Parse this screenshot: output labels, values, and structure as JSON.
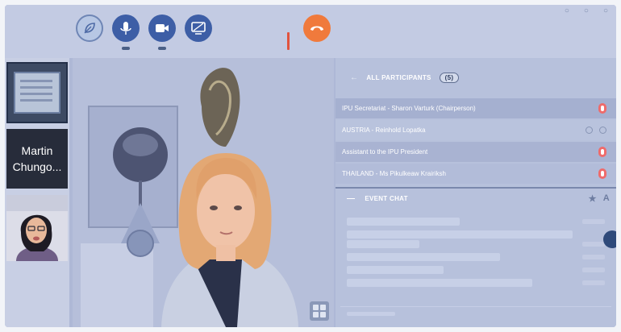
{
  "toolbar": {
    "buttons": [
      {
        "id": "reaction",
        "icon": "leaf-icon",
        "color": "#b9c9e6"
      },
      {
        "id": "mic",
        "icon": "microphone-icon",
        "color": "#3d5ea6"
      },
      {
        "id": "camera",
        "icon": "camera-icon",
        "color": "#3d5ea6"
      },
      {
        "id": "share",
        "icon": "screen-share-icon",
        "color": "#3d5ea6"
      },
      {
        "id": "hangup",
        "icon": "hang-up-icon",
        "color": "#f07a3c"
      }
    ]
  },
  "thumbnails": {
    "name_tile": "Martin Chungo..."
  },
  "participants": {
    "header": "ALL PARTICIPANTS",
    "count": "(5)",
    "rows": [
      {
        "name": "IPU Secretariat - Sharon Varturk (Chairperson)",
        "muted": true
      },
      {
        "name": "AUSTRIA - Reinhold Lopatka",
        "muted": false
      },
      {
        "name": "Assistant to the IPU President",
        "muted": true
      },
      {
        "name": "THAILAND - Ms Pikulkeaw Krairiksh",
        "muted": true
      }
    ]
  },
  "chat": {
    "header": "EVENT CHAT"
  },
  "colors": {
    "accent": "#3d5ea6",
    "hangup": "#f07a3c",
    "muted": "#ef6b6b"
  }
}
